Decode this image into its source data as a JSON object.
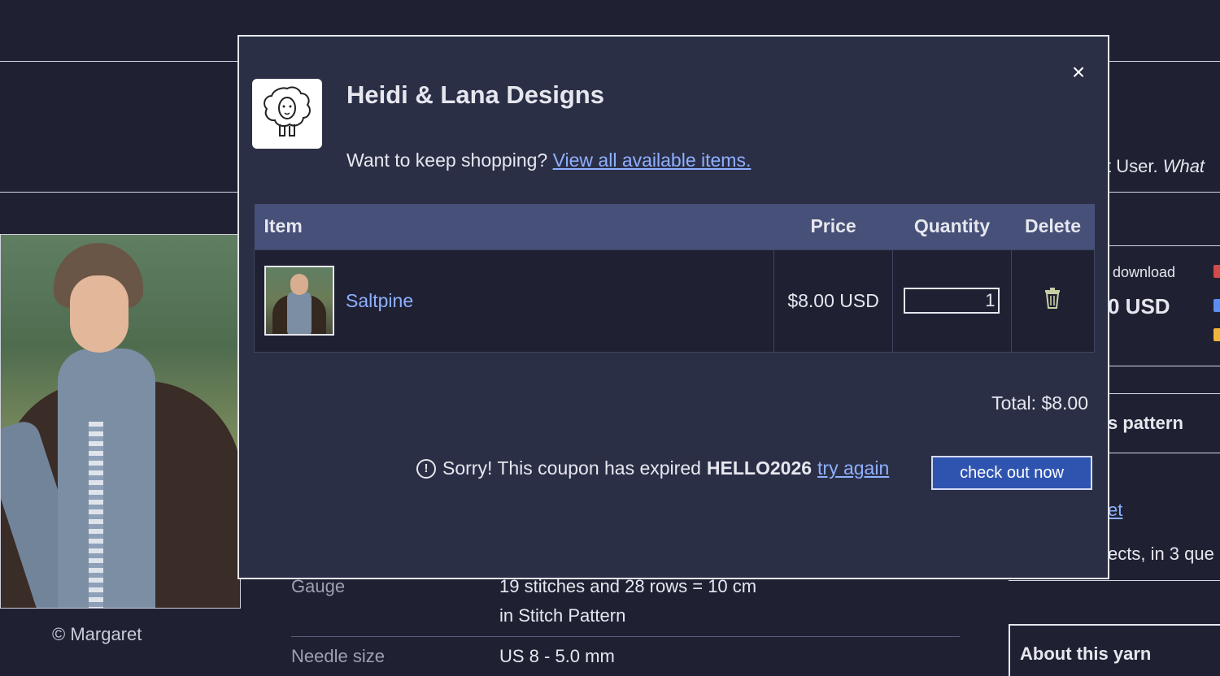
{
  "background": {
    "photo_caption": "© Margaret",
    "details": [
      {
        "label": "Gauge",
        "value_lines": [
          "19 stitches and 28 rows = 10 cm",
          "in Stitch Pattern"
        ]
      },
      {
        "label": "Needle size",
        "value_lines": [
          "US 8 - 5.0 mm"
        ]
      }
    ],
    "right_column": {
      "user_text_prefix": "t User. ",
      "user_text_italic": "What",
      "download_label": "download",
      "price_partial": "0 USD",
      "pattern_partial": "s pattern",
      "link_partial": "et",
      "projects_partial": "ects, in 3 que",
      "about_yarn": "About this yarn"
    }
  },
  "modal": {
    "close_symbol": "×",
    "shop_name": "Heidi & Lana Designs",
    "keep_shopping_text": "Want to keep shopping?",
    "keep_shopping_link": "View all available items.",
    "table": {
      "headers": {
        "item": "Item",
        "price": "Price",
        "quantity": "Quantity",
        "delete": "Delete"
      },
      "rows": [
        {
          "name": "Saltpine",
          "price": "$8.00 USD",
          "quantity": "1"
        }
      ]
    },
    "total": "Total: $8.00",
    "coupon": {
      "icon": "!",
      "message": "Sorry! This coupon has expired",
      "code": "HELLO2026",
      "retry_link": "try again"
    },
    "checkout_label": "check out now"
  },
  "colors": {
    "page_bg": "#1f2133",
    "modal_bg": "#2b2f46",
    "table_header_bg": "#465078",
    "link": "#8fb0ff",
    "button_bg": "#2f54b0"
  }
}
